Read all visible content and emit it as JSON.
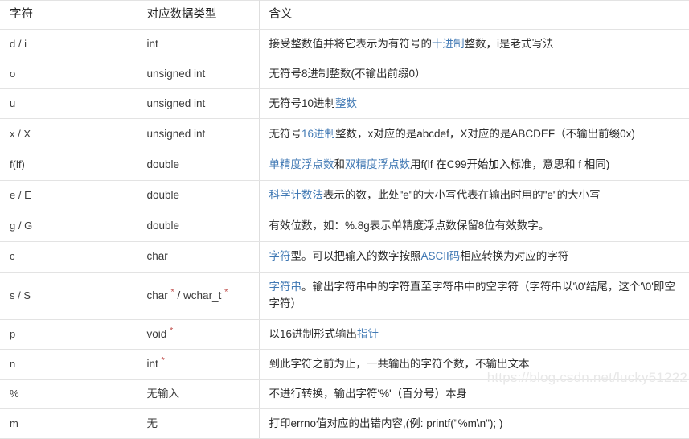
{
  "table": {
    "columns": [
      "字符",
      "对应数据类型",
      "含义"
    ],
    "watermark": "https://blog.csdn.net/lucky51222",
    "colors": {
      "link_blue": "#4179b4",
      "pointer_star_red": "#c0504d",
      "body_text": "#2b2b2b",
      "border": "#e3e3e3",
      "watermark": "#e8e8e8",
      "background": "#ffffff"
    },
    "rows": [
      {
        "char": "d / i",
        "type": "int",
        "meaning_parts": [
          {
            "text": "接受整数值并将它表示为有符号的",
            "link": false
          },
          {
            "text": "十进制",
            "link": true
          },
          {
            "text": "整数，i是老式写法",
            "link": false
          }
        ]
      },
      {
        "char": "o",
        "type": "unsigned int",
        "meaning_parts": [
          {
            "text": "无符号8进制整数(不输出前缀0）",
            "link": false
          }
        ]
      },
      {
        "char": "u",
        "type": "unsigned int",
        "meaning_parts": [
          {
            "text": "无符号10进制",
            "link": false
          },
          {
            "text": "整数",
            "link": true
          }
        ]
      },
      {
        "char": "x / X",
        "type": "unsigned int",
        "meaning_parts": [
          {
            "text": "无符号",
            "link": false
          },
          {
            "text": "16进制",
            "link": true
          },
          {
            "text": "整数，x对应的是abcdef，X对应的是ABCDEF（不输出前缀0x)",
            "link": false
          }
        ]
      },
      {
        "char": "f(lf)",
        "type": "double",
        "meaning_parts": [
          {
            "text": "单精度浮点数",
            "link": true
          },
          {
            "text": "和",
            "link": false
          },
          {
            "text": "双精度浮点数",
            "link": true
          },
          {
            "text": "用f(lf 在C99开始加入标准，意思和 f 相同)",
            "link": false
          }
        ]
      },
      {
        "char": "e / E",
        "type": "double",
        "meaning_parts": [
          {
            "text": "科学计数法",
            "link": true
          },
          {
            "text": "表示的数，此处\"e\"的大小写代表在输出时用的\"e\"的大小写",
            "link": false
          }
        ]
      },
      {
        "char": "g / G",
        "type": "double",
        "meaning_parts": [
          {
            "text": "有效位数，如：%.8g表示单精度浮点数保留8位有效数字。",
            "link": false
          }
        ]
      },
      {
        "char": "c",
        "type": "char",
        "meaning_parts": [
          {
            "text": "字符",
            "link": true
          },
          {
            "text": "型。可以把输入的数字按照",
            "link": false
          },
          {
            "text": "ASCII码",
            "link": true
          },
          {
            "text": "相应转换为对应的字符",
            "link": false
          }
        ]
      },
      {
        "char": "s / S",
        "type": "char * / wchar_t *",
        "type_stars": true,
        "meaning_parts": [
          {
            "text": "字符串",
            "link": true
          },
          {
            "text": "。输出字符串中的字符直至字符串中的空字符（字符串以'\\0'结尾，这个'\\0'即空字符）",
            "link": false
          }
        ]
      },
      {
        "char": "p",
        "type": "void *",
        "type_stars": true,
        "meaning_parts": [
          {
            "text": "以16进制形式输出",
            "link": false
          },
          {
            "text": "指针",
            "link": true
          }
        ]
      },
      {
        "char": "n",
        "type": "int *",
        "type_stars": true,
        "meaning_parts": [
          {
            "text": "到此字符之前为止，一共输出的字符个数，不输出文本",
            "link": false
          }
        ]
      },
      {
        "char": "%",
        "type": "无输入",
        "meaning_parts": [
          {
            "text": "不进行转换，输出字符'%'（百分号）本身",
            "link": false
          }
        ]
      },
      {
        "char": "m",
        "type": "无",
        "meaning_parts": [
          {
            "text": "打印errno值对应的出错内容,(例: printf(\"%m\\n\"); )",
            "link": false
          }
        ]
      }
    ]
  }
}
